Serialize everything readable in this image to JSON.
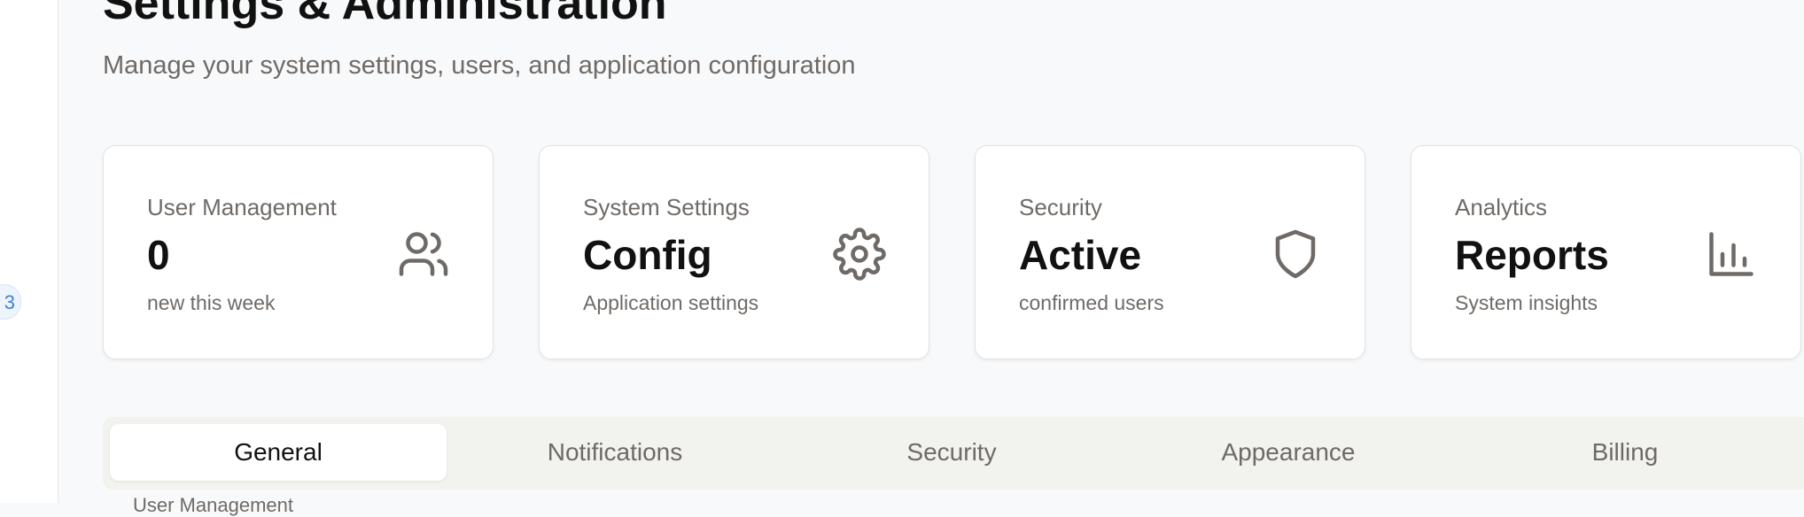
{
  "sidebar": {
    "badge": "3"
  },
  "header": {
    "title": "Settings & Administration",
    "subtitle": "Manage your system settings, users, and application configuration"
  },
  "cards": [
    {
      "label": "User Management",
      "value": "0",
      "desc": "new this week",
      "icon": "users-icon"
    },
    {
      "label": "System Settings",
      "value": "Config",
      "desc": "Application settings",
      "icon": "gear-icon"
    },
    {
      "label": "Security",
      "value": "Active",
      "desc": "confirmed users",
      "icon": "shield-icon"
    },
    {
      "label": "Analytics",
      "value": "Reports",
      "desc": "System insights",
      "icon": "bar-chart-icon"
    }
  ],
  "tabs": [
    {
      "label": "General",
      "active": true
    },
    {
      "label": "Notifications",
      "active": false
    },
    {
      "label": "Security",
      "active": false
    },
    {
      "label": "Appearance",
      "active": false
    },
    {
      "label": "Billing",
      "active": false
    }
  ],
  "section": {
    "heading": "User Management"
  },
  "colors": {
    "background": "#f8f9fa",
    "card": "#ffffff",
    "muted_text": "#6f6a66",
    "tab_bar": "#f2f2ef",
    "badge_blue": "#3b82d6"
  }
}
